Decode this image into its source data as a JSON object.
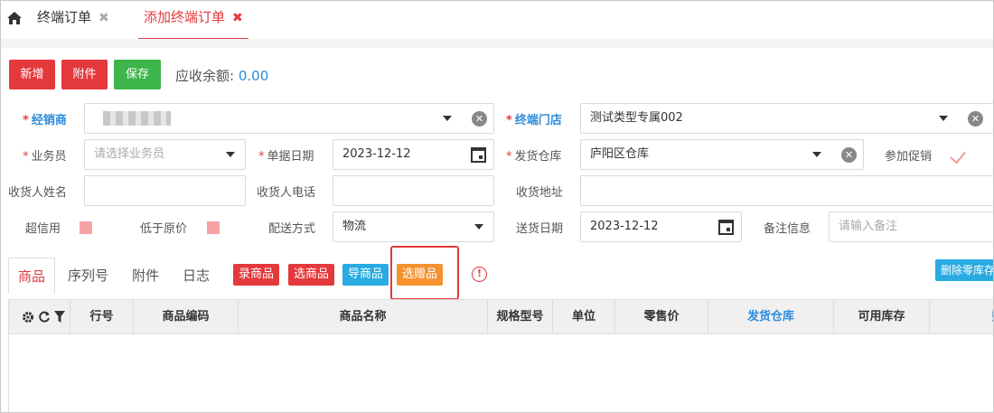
{
  "tabs": [
    {
      "label": "终端订单",
      "active": false
    },
    {
      "label": "添加终端订单",
      "active": true
    }
  ],
  "toolbar": {
    "new_label": "新增",
    "attach_label": "附件",
    "save_label": "保存",
    "balance_label": "应收余额:",
    "balance_value": "0.00"
  },
  "form": {
    "dealer_label": "经销商",
    "store_label": "终端门店",
    "store_value": "测试类型专属002",
    "salesman_label": "业务员",
    "salesman_placeholder": "请选择业务员",
    "date_label": "单据日期",
    "date_value": "2023-12-12",
    "warehouse_label": "发货仓库",
    "warehouse_value": "庐阳区仓库",
    "promo_label": "参加促销",
    "recv_name_label": "收货人姓名",
    "recv_phone_label": "收货人电话",
    "recv_addr_label": "收货地址",
    "overcredit_label": "超信用",
    "below_price_label": "低于原价",
    "delivery_label": "配送方式",
    "delivery_value": "物流",
    "ship_date_label": "送货日期",
    "ship_date_value": "2023-12-12",
    "remark_label": "备注信息",
    "remark_placeholder": "请输入备注"
  },
  "subtabs": [
    "商品",
    "序列号",
    "附件",
    "日志"
  ],
  "actions": {
    "enter_goods": "录商品",
    "select_goods": "选商品",
    "import_goods": "导商品",
    "select_gift": "选赠品",
    "delete_zero": "删除零库存"
  },
  "grid": {
    "columns": [
      "行号",
      "商品编码",
      "商品名称",
      "规格型号",
      "单位",
      "零售价",
      "发货仓库",
      "可用库存",
      "数"
    ]
  },
  "colors": {
    "primary": "#e4393c",
    "success": "#3cb54a",
    "info": "#29abe2",
    "warning": "#f5922f",
    "link": "#2c8cdc"
  }
}
